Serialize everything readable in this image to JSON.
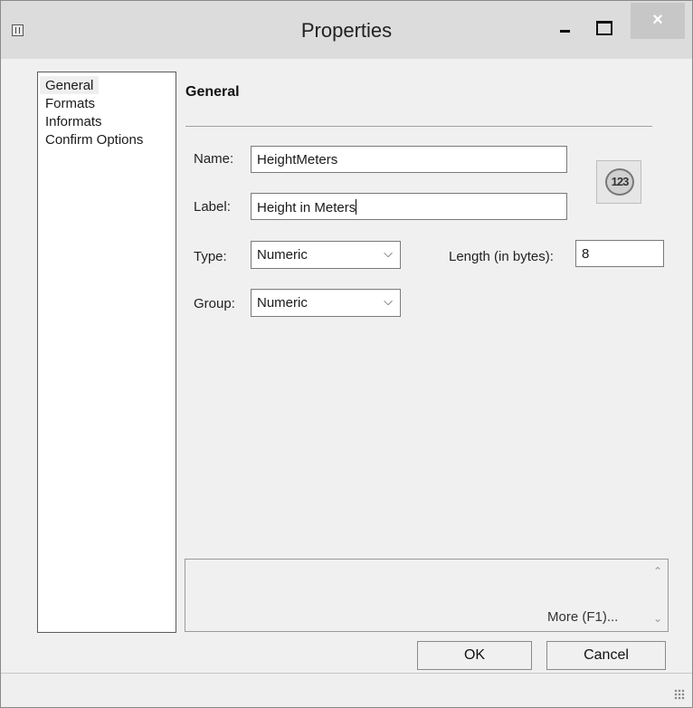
{
  "window": {
    "title": "Properties",
    "close_glyph": "×"
  },
  "nav": {
    "items": [
      {
        "label": "General",
        "selected": true
      },
      {
        "label": "Formats",
        "selected": false
      },
      {
        "label": "Informats",
        "selected": false
      },
      {
        "label": "Confirm Options",
        "selected": false
      }
    ]
  },
  "general": {
    "section_title": "General",
    "name_label": "Name:",
    "name_value": "HeightMeters",
    "label_label": "Label:",
    "label_value": "Height in Meters",
    "type_label": "Type:",
    "type_value": "Numeric",
    "length_label": "Length (in bytes):",
    "length_value": "8",
    "group_label": "Group:",
    "group_value": "Numeric",
    "type_icon_text": "123",
    "type_icon_name": "numeric-type-icon"
  },
  "help": {
    "more_label": "More (F1)...",
    "scroll_up_glyph": "^",
    "scroll_down_glyph": "v"
  },
  "buttons": {
    "ok_label": "OK",
    "cancel_label": "Cancel"
  },
  "icons": {
    "app_icon": "properties-window-icon",
    "minimize": "minimize-icon",
    "maximize": "maximize-icon",
    "close": "close-icon",
    "dropdown": "chevron-down-icon",
    "resize_grip": "resize-grip-icon"
  }
}
